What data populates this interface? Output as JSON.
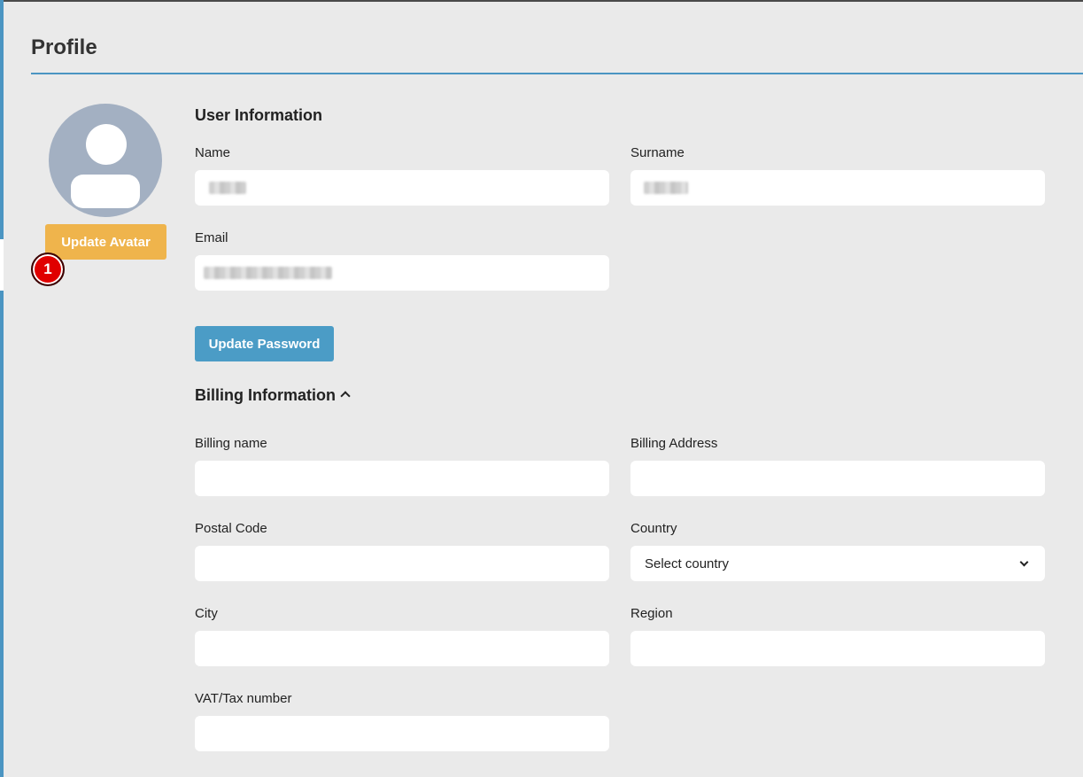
{
  "page": {
    "title": "Profile"
  },
  "avatar": {
    "update_label": "Update Avatar",
    "badge_number": "1"
  },
  "user_info": {
    "title": "User Information",
    "name_label": "Name",
    "surname_label": "Surname",
    "email_label": "Email",
    "update_password_label": "Update Password"
  },
  "billing": {
    "title": "Billing Information",
    "billing_name_label": "Billing name",
    "billing_address_label": "Billing Address",
    "postal_code_label": "Postal Code",
    "country_label": "Country",
    "country_selected": "Select country",
    "city_label": "City",
    "region_label": "Region",
    "vat_label": "VAT/Tax number"
  },
  "colors": {
    "accent": "#4b95c2",
    "avatar_button": "#efb44c",
    "password_button": "#4b9cc6",
    "badge": "#e00000",
    "background": "#eaeaea"
  },
  "icons": {
    "avatar": "user-silhouette-icon",
    "billing_toggle": "chevron-up-icon",
    "country_select": "chevron-down-icon"
  }
}
